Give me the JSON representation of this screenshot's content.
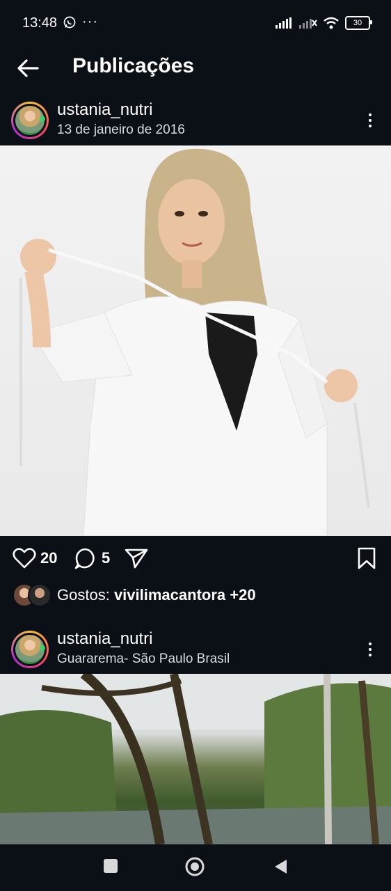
{
  "status_bar": {
    "time": "13:48",
    "more": "···",
    "battery": "30"
  },
  "header": {
    "title": "Publicações"
  },
  "posts": [
    {
      "username": "ustania_nutri",
      "subtitle": "13 de janeiro de 2016",
      "likes": "20",
      "comments": "5",
      "liked_by_label": "Gostos:",
      "liked_by_user": "vivilimacantora",
      "liked_by_more": "+20"
    },
    {
      "username": "ustania_nutri",
      "subtitle": "Guararema- São Paulo Brasil"
    }
  ],
  "icons": {
    "back": "arrow-left-icon",
    "menu": "kebab-icon",
    "like": "heart-icon",
    "comment": "comment-icon",
    "share": "send-icon",
    "save": "bookmark-icon",
    "whatsapp": "whatsapp-icon",
    "signal": "signal-icon",
    "wifi": "wifi-icon",
    "battery": "battery-icon",
    "nav_recents": "square-icon",
    "nav_home": "circle-icon",
    "nav_back": "triangle-icon"
  },
  "colors": {
    "background": "#0b0f16",
    "text": "#ffffff",
    "story_ring": "#f5475c"
  }
}
